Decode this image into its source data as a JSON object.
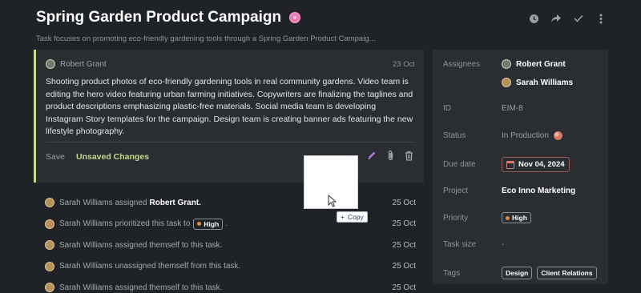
{
  "header": {
    "title": "Spring Garden Product Campaign",
    "title_emoji": "cherry-blossom-icon",
    "subtitle": "Task focuses on promoting eco-friendly gardening tools through a Spring Garden Product Campaig...",
    "actions": [
      "clock-icon",
      "share-icon",
      "check-icon",
      "more-icon"
    ]
  },
  "comment": {
    "author": "Robert Grant",
    "date": "23 Oct",
    "body": "Shooting product photos of eco-friendly gardening tools in real community gardens. Video team is editing the hero video featuring urban farming initiatives. Copywriters are finalizing the taglines and product descriptions emphasizing plastic-free materials. Social media team is developing Instagram Story templates for the campaign. Design team is creating banner ads featuring the new lifestyle photography.",
    "save_label": "Save",
    "unsaved_label": "Unsaved Changes",
    "accent": "#cbd98a"
  },
  "activity": [
    {
      "text": "Sarah Williams assigned",
      "bold": "Robert Grant.",
      "date": "25 Oct"
    },
    {
      "text": "Sarah Williams prioritized this task to",
      "chip": "High",
      "suffix": ".",
      "date": "25 Oct"
    },
    {
      "text": "Sarah Williams assigned themself to this task.",
      "date": "25 Oct"
    },
    {
      "text": "Sarah Williams unassigned themself from this task.",
      "date": "25 Oct"
    },
    {
      "text": "Sarah Williams assigned themself to this task.",
      "date": "25 Oct"
    }
  ],
  "drag": {
    "copy_label": "Copy",
    "copy_prefix": "+"
  },
  "details": {
    "assignees_label": "Assignees",
    "assignees": [
      "Robert Grant",
      "Sarah Williams"
    ],
    "id_label": "ID",
    "id": "EIM-8",
    "status_label": "Status",
    "status": "In Production",
    "due_label": "Due date",
    "due": "Nov 04, 2024",
    "project_label": "Project",
    "project": "Eco Inno Marketing",
    "priority_label": "Priority",
    "priority": "High",
    "size_label": "Task size",
    "size": "-",
    "tags_label": "Tags",
    "tags": [
      "Design",
      "Client Relations"
    ]
  }
}
